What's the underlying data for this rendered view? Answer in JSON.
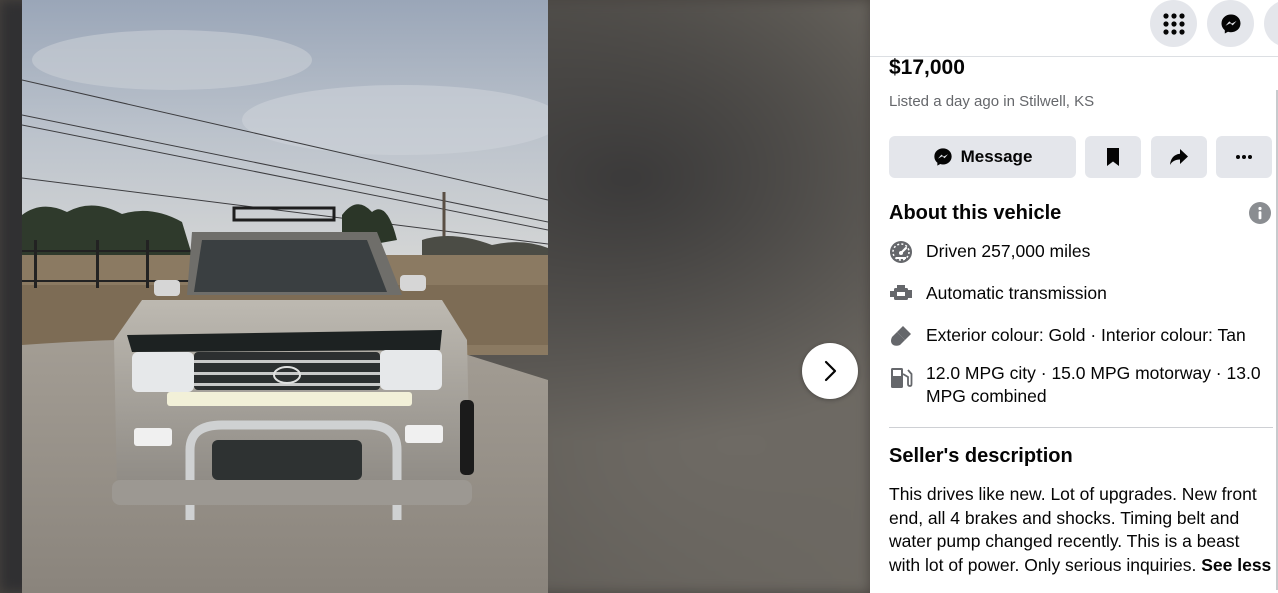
{
  "viewer": {
    "photo_subject": "toyota-land-cruiser-front-photo",
    "next_icon": "chevron-right-icon"
  },
  "topbar": {
    "menu_icon": "grid-menu-icon",
    "messenger_icon": "messenger-icon"
  },
  "listing": {
    "price": "$17,000",
    "listed": "Listed a day ago in Stilwell, KS"
  },
  "actions": {
    "message_label": "Message",
    "message_icon": "messenger-icon",
    "save_icon": "bookmark-icon",
    "share_icon": "share-icon",
    "more_icon": "more-icon"
  },
  "about": {
    "title": "About this vehicle",
    "items": [
      {
        "icon": "speedometer-icon",
        "text": "Driven 257,000 miles"
      },
      {
        "icon": "engine-icon",
        "text": "Automatic transmission"
      },
      {
        "icon": "paint-brush-icon",
        "text": "Exterior colour: Gold · Interior colour: Tan"
      },
      {
        "icon": "fuel-pump-icon",
        "text": "12.0 MPG city · 15.0 MPG motorway · 13.0 MPG combined"
      }
    ]
  },
  "seller": {
    "title": "Seller's description",
    "description": "This drives like new. Lot of upgrades. New front end, all 4 brakes and shocks. Timing belt and water pump changed recently. This is a beast with lot of power. Only serious inquiries. ",
    "see_less": "See less"
  },
  "colors": {
    "accent_gray": "#e4e6eb",
    "text_primary": "#050505",
    "text_secondary": "#65676b"
  }
}
